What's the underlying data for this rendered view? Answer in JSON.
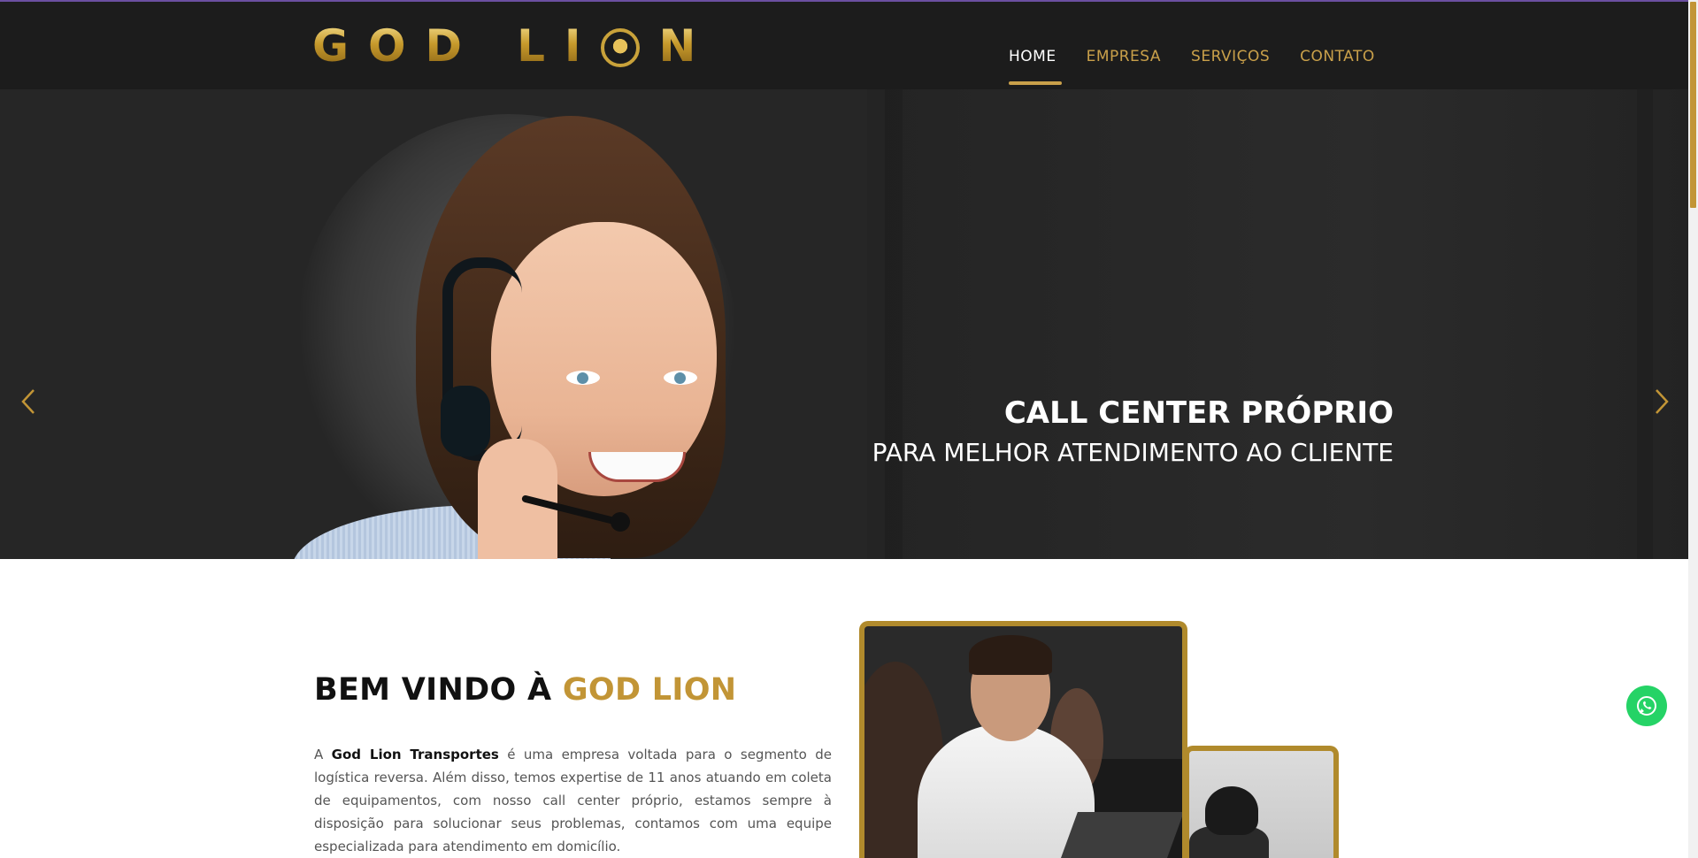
{
  "header": {
    "logo": {
      "word1": "GOD",
      "word2_pre": "LI",
      "word2_post": "N"
    },
    "nav": [
      {
        "label": "HOME",
        "active": true
      },
      {
        "label": "EMPRESA",
        "active": false
      },
      {
        "label": "SERVIÇOS",
        "active": false
      },
      {
        "label": "CONTATO",
        "active": false
      }
    ]
  },
  "hero": {
    "title": "CALL CENTER PRÓPRIO",
    "subtitle": "PARA MELHOR ATENDIMENTO AO CLIENTE",
    "prev_icon": "chevron-left-icon",
    "next_icon": "chevron-right-icon"
  },
  "welcome": {
    "title_plain": "BEM VINDO À ",
    "title_accent": "GOD LION",
    "text_pre": "A ",
    "text_bold": "God Lion Transportes",
    "text_post": " é uma empresa voltada para o segmento de logística reversa. Além disso, temos expertise de 11 anos atuando em coleta de equipamentos, com nosso call center próprio, estamos sempre à disposição para solucionar seus problemas, contamos com uma equipe especializada para atendimento em domicílio."
  },
  "floating": {
    "icon": "whatsapp-icon"
  },
  "colors": {
    "gold": "#c29536",
    "dark": "#1c1c1c",
    "whatsapp": "#25d366"
  }
}
